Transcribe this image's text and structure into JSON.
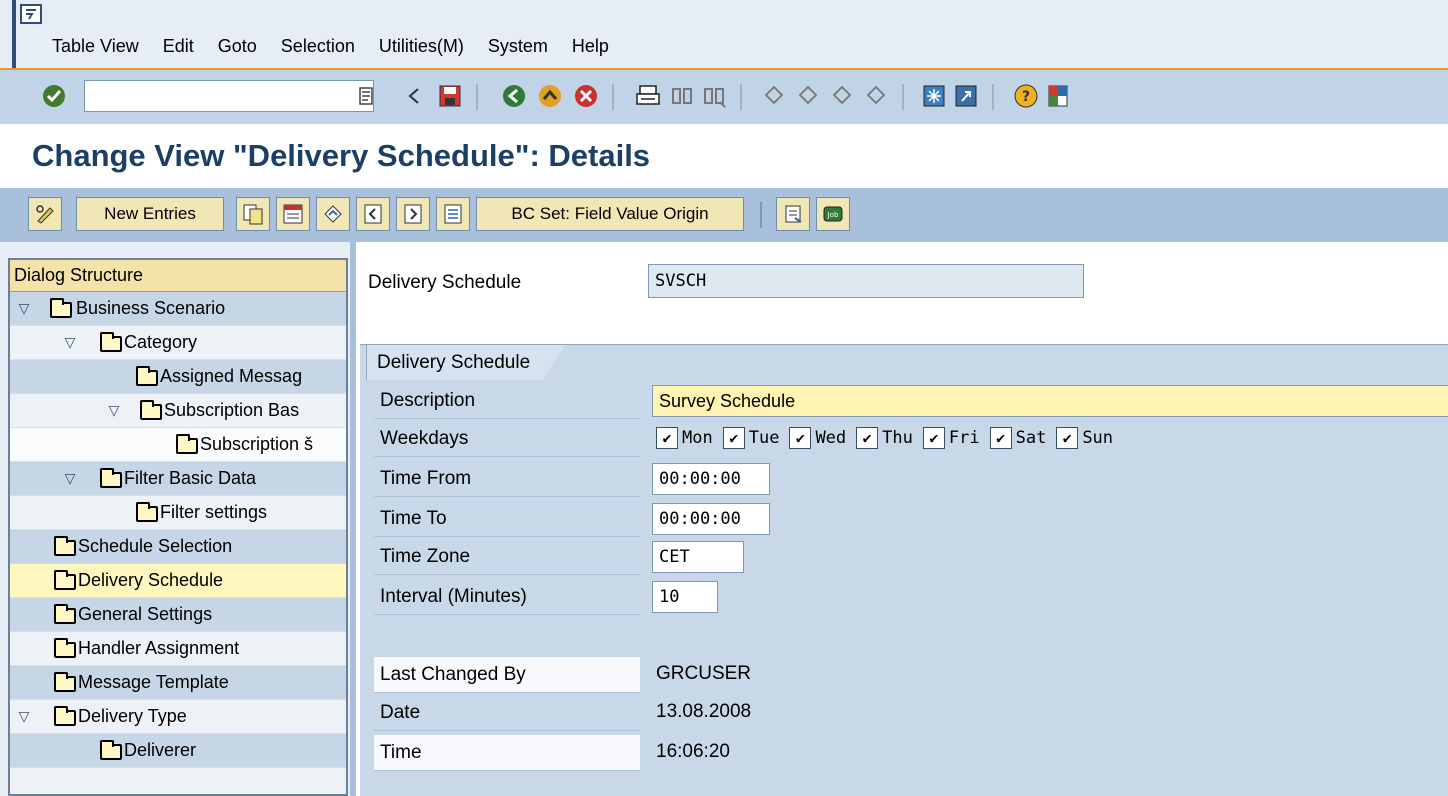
{
  "menu": {
    "items": [
      {
        "label": "Table View"
      },
      {
        "label": "Edit"
      },
      {
        "label": "Goto"
      },
      {
        "label": "Selection"
      },
      {
        "label": "Utilities(M)"
      },
      {
        "label": "System"
      },
      {
        "label": "Help"
      }
    ]
  },
  "toolbar": {
    "okcode_value": ""
  },
  "page": {
    "title": "Change View \"Delivery Schedule\": Details"
  },
  "app_toolbar": {
    "new_entries": "New Entries",
    "bc_set": "BC Set: Field Value Origin"
  },
  "dialog": {
    "header": "Dialog Structure",
    "nodes": [
      {
        "label": "Business Scenario"
      },
      {
        "label": "Category"
      },
      {
        "label": "Assigned Messaɡ"
      },
      {
        "label": "Subscription Bas"
      },
      {
        "label": "Subscription š"
      },
      {
        "label": "Filter Basic Data"
      },
      {
        "label": "Filter settings"
      },
      {
        "label": "Schedule Selection"
      },
      {
        "label": "Delivery Schedule"
      },
      {
        "label": "General Settings"
      },
      {
        "label": "Handler Assignment"
      },
      {
        "label": "Message Template"
      },
      {
        "label": "Delivery Type"
      },
      {
        "label": "Deliverer"
      }
    ]
  },
  "detail": {
    "key_label": "Delivery Schedule",
    "key_value": "SVSCH",
    "group_title": "Delivery Schedule",
    "description_label": "Description",
    "description_value": "Survey Schedule",
    "weekdays_label": "Weekdays",
    "weekdays": [
      {
        "label": "Mon",
        "checked": true
      },
      {
        "label": "Tue",
        "checked": true
      },
      {
        "label": "Wed",
        "checked": true
      },
      {
        "label": "Thu",
        "checked": true
      },
      {
        "label": "Fri",
        "checked": true
      },
      {
        "label": "Sat",
        "checked": true
      },
      {
        "label": "Sun",
        "checked": true
      }
    ],
    "time_from_label": "Time From",
    "time_from_value": "00:00:00",
    "time_to_label": "Time To",
    "time_to_value": "00:00:00",
    "time_zone_label": "Time Zone",
    "time_zone_value": "CET",
    "interval_label": "Interval (Minutes)",
    "interval_value": "10",
    "last_changed_label": "Last Changed By",
    "last_changed_value": "GRCUSER",
    "date_label": "Date",
    "date_value": "13.08.2008",
    "time_label": "Time",
    "time_value": "16:06:20"
  }
}
